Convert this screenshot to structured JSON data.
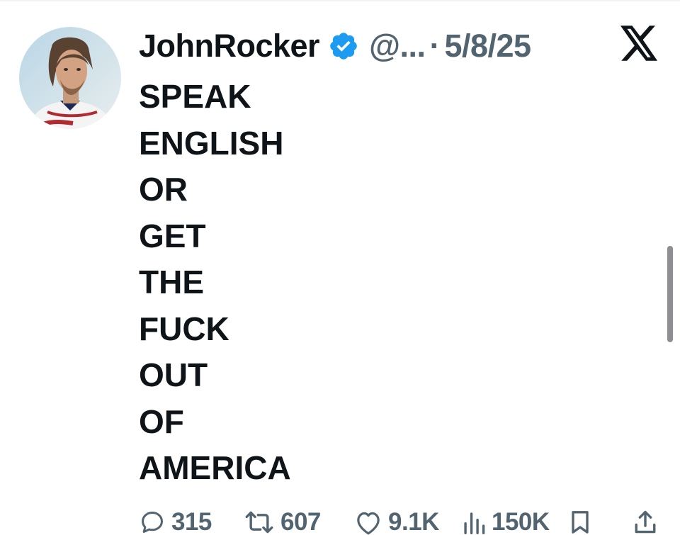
{
  "tweet": {
    "display_name": "JohnRocker",
    "handle": "@...",
    "separator": "·",
    "date": "5/8/25",
    "verified": true,
    "lines": [
      "SPEAK",
      "ENGLISH",
      "OR",
      "GET",
      "THE",
      "FUCK",
      "OUT",
      "OF",
      "AMERICA"
    ]
  },
  "actions": {
    "replies": "315",
    "reposts": "607",
    "likes": "9.1K",
    "views": "150K"
  },
  "colors": {
    "text": "#0f1419",
    "muted": "#536471",
    "verified_blue": "#1d9bf0",
    "background": "#ffffff"
  },
  "icons": {
    "brand": "x-logo-icon",
    "verified": "verified-badge-icon",
    "reply": "reply-icon",
    "repost": "repost-icon",
    "like": "like-icon",
    "views": "views-icon",
    "bookmark": "bookmark-icon",
    "share": "share-icon"
  }
}
